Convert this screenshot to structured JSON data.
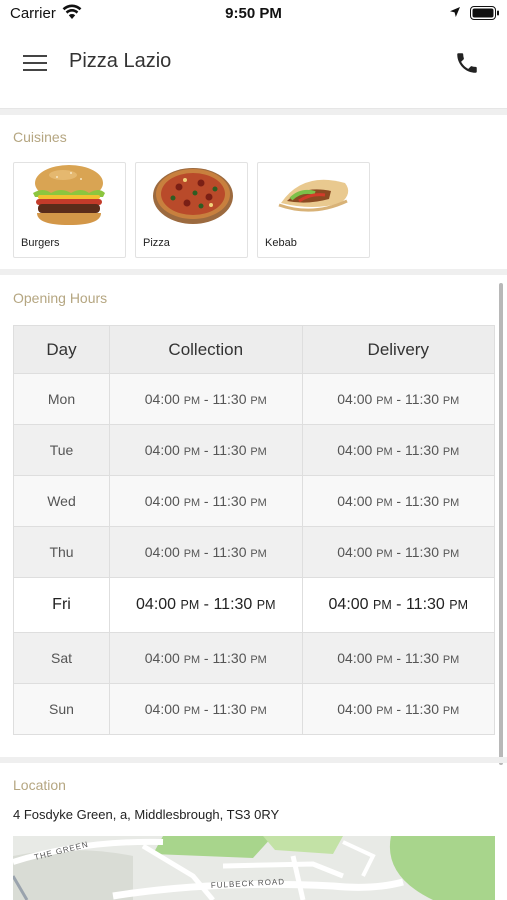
{
  "status_bar": {
    "carrier": "Carrier",
    "time": "9:50 PM"
  },
  "header": {
    "title": "Pizza Lazio"
  },
  "cuisines": {
    "title": "Cuisines",
    "items": [
      {
        "label": "Burgers",
        "icon": "burger-image"
      },
      {
        "label": "Pizza",
        "icon": "pizza-image"
      },
      {
        "label": "Kebab",
        "icon": "kebab-image"
      }
    ]
  },
  "opening_hours": {
    "title": "Opening Hours",
    "columns": [
      "Day",
      "Collection",
      "Delivery"
    ],
    "rows": [
      {
        "day": "Mon",
        "collection_start": "04:00",
        "collection_end": "11:30",
        "delivery_start": "04:00",
        "delivery_end": "11:30"
      },
      {
        "day": "Tue",
        "collection_start": "04:00",
        "collection_end": "11:30",
        "delivery_start": "04:00",
        "delivery_end": "11:30"
      },
      {
        "day": "Wed",
        "collection_start": "04:00",
        "collection_end": "11:30",
        "delivery_start": "04:00",
        "delivery_end": "11:30"
      },
      {
        "day": "Thu",
        "collection_start": "04:00",
        "collection_end": "11:30",
        "delivery_start": "04:00",
        "delivery_end": "11:30"
      },
      {
        "day": "Fri",
        "collection_start": "04:00",
        "collection_end": "11:30",
        "delivery_start": "04:00",
        "delivery_end": "11:30"
      },
      {
        "day": "Sat",
        "collection_start": "04:00",
        "collection_end": "11:30",
        "delivery_start": "04:00",
        "delivery_end": "11:30"
      },
      {
        "day": "Sun",
        "collection_start": "04:00",
        "collection_end": "11:30",
        "delivery_start": "04:00",
        "delivery_end": "11:30"
      }
    ],
    "meridiem": "PM",
    "highlighted_day": "Fri"
  },
  "location": {
    "title": "Location",
    "address": "4 Fosdyke Green, a, Middlesbrough, TS3 0RY",
    "map_labels": [
      "THE GREEN",
      "FULBECK ROAD"
    ]
  },
  "colors": {
    "section_title": "#b5a681",
    "park_green": "#a8d58c",
    "separator": "#efefef"
  }
}
